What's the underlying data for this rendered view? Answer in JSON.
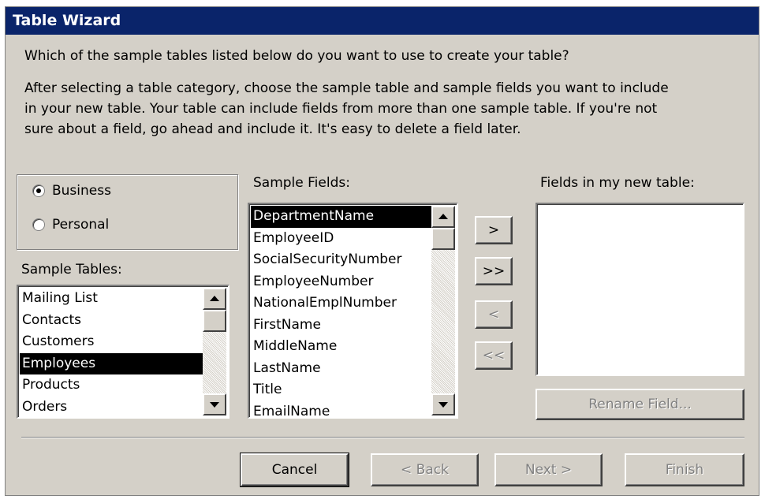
{
  "window": {
    "title": "Table Wizard"
  },
  "question": "Which of the sample tables listed below do you want to use to create your table?",
  "instructions": [
    "After selecting a table category, choose the sample table and sample fields you want to include",
    "in your new table. Your table can include fields from more than one sample table. If you're not",
    "sure about a field, go ahead and include it. It's easy to delete a field later."
  ],
  "category": {
    "options": [
      {
        "label": "Business",
        "checked": true
      },
      {
        "label": "Personal",
        "checked": false
      }
    ]
  },
  "sample_tables": {
    "label": "Sample Tables:",
    "items": [
      "Mailing List",
      "Contacts",
      "Customers",
      "Employees",
      "Products",
      "Orders"
    ],
    "selected": "Employees"
  },
  "sample_fields": {
    "label": "Sample Fields:",
    "items": [
      "DepartmentName",
      "EmployeeID",
      "SocialSecurityNumber",
      "EmployeeNumber",
      "NationalEmplNumber",
      "FirstName",
      "MiddleName",
      "LastName",
      "Title",
      "EmailName"
    ],
    "selected": "DepartmentName"
  },
  "new_table": {
    "label": "Fields in my new table:",
    "items": []
  },
  "move_buttons": {
    "add_one": ">",
    "add_all": ">>",
    "remove_one": "<",
    "remove_all": "<<"
  },
  "rename_field_button": "Rename Field...",
  "footer": {
    "cancel": "Cancel",
    "back": "< Back",
    "next": "Next >",
    "finish": "Finish"
  }
}
